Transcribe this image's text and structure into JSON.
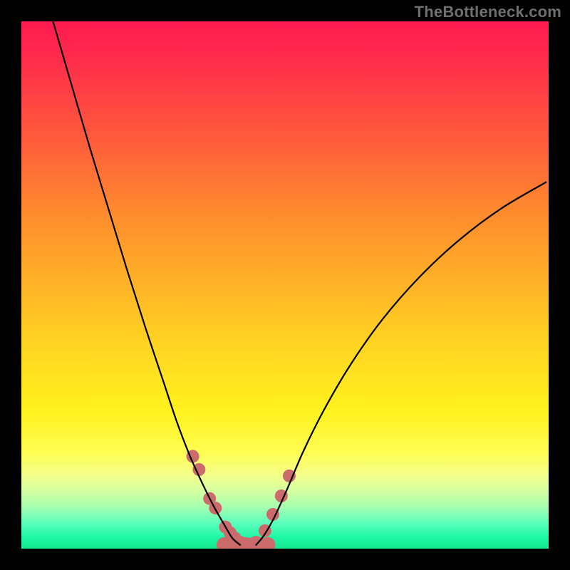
{
  "watermark": "TheBottleneck.com",
  "chart_data": {
    "type": "line",
    "title": "",
    "xlabel": "",
    "ylabel": "",
    "xlim": [
      0,
      100
    ],
    "ylim": [
      0,
      100
    ],
    "note": "Axes are unlabeled in the image; values are normalized 0–100 estimates read from pixel positions.",
    "series": [
      {
        "name": "curve-left",
        "x": [
          6.0,
          9.5,
          13.0,
          16.5,
          20.0,
          23.5,
          27.0,
          29.5,
          32.0,
          34.5,
          36.5,
          38.5,
          40.0,
          41.5
        ],
        "y": [
          100.0,
          88.0,
          76.0,
          64.5,
          53.0,
          42.0,
          31.5,
          24.0,
          17.5,
          12.0,
          8.0,
          4.5,
          2.0,
          0.7
        ]
      },
      {
        "name": "curve-right",
        "x": [
          44.5,
          46.0,
          48.0,
          50.5,
          53.5,
          57.5,
          62.5,
          68.5,
          75.5,
          83.0,
          91.0,
          99.5
        ],
        "y": [
          0.7,
          2.5,
          6.0,
          11.5,
          18.5,
          26.5,
          35.0,
          43.5,
          51.5,
          58.5,
          64.5,
          69.5
        ]
      },
      {
        "name": "bottom-band-left-dots",
        "x": [
          32.5,
          33.7,
          35.7,
          36.8,
          38.7,
          39.6,
          40.5,
          41.5
        ],
        "y": [
          17.5,
          15.0,
          9.5,
          7.7,
          4.1,
          3.0,
          2.0,
          1.2
        ]
      },
      {
        "name": "bottom-band-right-dots",
        "x": [
          44.5,
          46.2,
          47.7,
          49.3,
          50.8
        ],
        "y": [
          1.2,
          3.4,
          6.5,
          10.0,
          13.8
        ]
      },
      {
        "name": "bottom-band-flat",
        "x": [
          38.5,
          39.9,
          41.2,
          42.6,
          44.0,
          45.3,
          46.7
        ],
        "y": [
          0.7,
          0.7,
          0.7,
          0.7,
          0.7,
          0.7,
          0.7
        ]
      }
    ],
    "styles": {
      "curve-left": {
        "stroke": "#000000",
        "width": 2.2
      },
      "curve-right": {
        "stroke": "#000000",
        "width": 2.2
      },
      "dots": {
        "fill": "#cc6b6c",
        "radius_px": 9
      },
      "flat_dots": {
        "fill": "#cc6b6c",
        "radius_px": 11
      }
    }
  }
}
